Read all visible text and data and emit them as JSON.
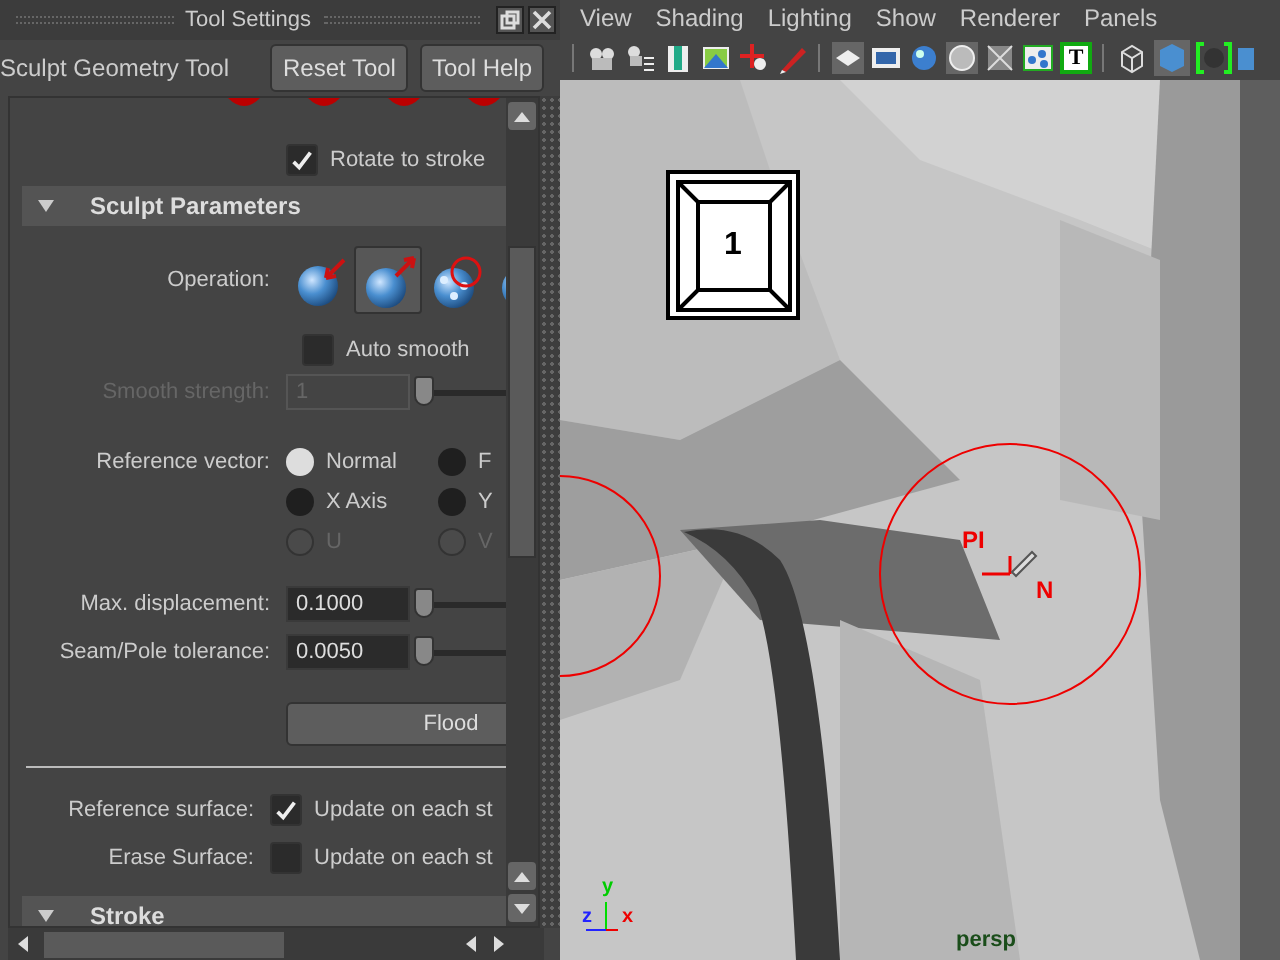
{
  "window": {
    "title": "Tool Settings"
  },
  "tool": {
    "name": "Sculpt Geometry Tool",
    "buttons": [
      "Reset Tool",
      "Tool Help"
    ]
  },
  "rotate_to_stroke": {
    "label": "Rotate to stroke",
    "checked": true
  },
  "sculpt_parameters": {
    "title": "Sculpt Parameters",
    "expanded": true,
    "operation": {
      "label": "Operation:",
      "options": [
        {
          "kind": "push",
          "selected": false
        },
        {
          "kind": "pull",
          "selected": true
        },
        {
          "kind": "smooth",
          "selected": false
        },
        {
          "kind": "relax",
          "selected": false
        }
      ]
    },
    "auto_smooth": {
      "label": "Auto smooth",
      "checked": false
    },
    "smooth_strength": {
      "label": "Smooth strength:",
      "value": "1",
      "disabled": true,
      "level": 0
    },
    "reference_vector": {
      "label": "Reference vector:",
      "options": [
        {
          "label": "Normal",
          "selected": true,
          "disabled": false
        },
        {
          "label": "F",
          "selected": false,
          "disabled": false
        },
        {
          "label": "X Axis",
          "selected": false,
          "disabled": false
        },
        {
          "label": "Y",
          "selected": false,
          "disabled": false
        },
        {
          "label": "U",
          "selected": false,
          "disabled": true
        },
        {
          "label": "V",
          "selected": false,
          "disabled": true
        }
      ]
    },
    "max_displacement": {
      "label": "Max. displacement:",
      "value": "0.1000",
      "level": 0
    },
    "seam_pole_tolerance": {
      "label": "Seam/Pole tolerance:",
      "value": "0.0050",
      "level": 0
    },
    "flood_button": "Flood",
    "reference_surface": {
      "label": "Reference surface:",
      "option": "Update on each st",
      "checked": true
    },
    "erase_surface": {
      "label": "Erase Surface:",
      "option": "Update on each st",
      "checked": false
    }
  },
  "stroke": {
    "title": "Stroke",
    "expanded": true
  },
  "viewport": {
    "menu": [
      "View",
      "Shading",
      "Lighting",
      "Show",
      "Renderer",
      "Panels"
    ],
    "toolbar_text_button": "T",
    "key_overlay": "1",
    "cursor_labels": [
      "PI",
      "N"
    ],
    "axis_labels": [
      "y",
      "z",
      "x"
    ],
    "camera": "persp"
  }
}
